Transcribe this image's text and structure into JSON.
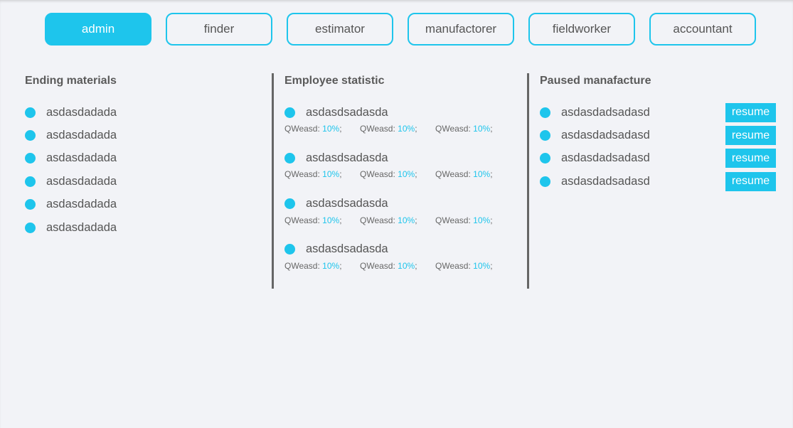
{
  "roles": [
    {
      "label": "admin",
      "active": true
    },
    {
      "label": "finder",
      "active": false
    },
    {
      "label": "estimator",
      "active": false
    },
    {
      "label": "manufactorer",
      "active": false
    },
    {
      "label": "fieldworker",
      "active": false
    },
    {
      "label": "accountant",
      "active": false
    }
  ],
  "ending_materials": {
    "title": "Ending materials",
    "items": [
      "asdasdadada",
      "asdasdadada",
      "asdasdadada",
      "asdasdadada",
      "asdasdadada",
      "asdasdadada"
    ]
  },
  "employee_statistic": {
    "title": "Employee statistic",
    "employees": [
      {
        "name": "asdasdsadasda",
        "stats": [
          {
            "label": "QWeasd:",
            "value": "10%",
            "sep": ";"
          },
          {
            "label": "QWeasd:",
            "value": "10%",
            "sep": ";"
          },
          {
            "label": "QWeasd:",
            "value": "10%",
            "sep": ";"
          }
        ]
      },
      {
        "name": "asdasdsadasda",
        "stats": [
          {
            "label": "QWeasd:",
            "value": "10%",
            "sep": ";"
          },
          {
            "label": "QWeasd:",
            "value": "10%",
            "sep": ";"
          },
          {
            "label": "QWeasd:",
            "value": "10%",
            "sep": ";"
          }
        ]
      },
      {
        "name": "asdasdsadasda",
        "stats": [
          {
            "label": "QWeasd:",
            "value": "10%",
            "sep": ";"
          },
          {
            "label": "QWeasd:",
            "value": "10%",
            "sep": ";"
          },
          {
            "label": "QWeasd:",
            "value": "10%",
            "sep": ";"
          }
        ]
      },
      {
        "name": "asdasdsadasda",
        "stats": [
          {
            "label": "QWeasd:",
            "value": "10%",
            "sep": ";"
          },
          {
            "label": "QWeasd:",
            "value": "10%",
            "sep": ";"
          },
          {
            "label": "QWeasd:",
            "value": "10%",
            "sep": ";"
          }
        ]
      }
    ]
  },
  "paused_manufacture": {
    "title": "Paused manafacture",
    "items": [
      {
        "name": "asdasdadsadasd",
        "action": "resume"
      },
      {
        "name": "asdasdadsadasd",
        "action": "resume"
      },
      {
        "name": "asdasdadsadasd",
        "action": "resume"
      },
      {
        "name": "asdasdadsadasd",
        "action": "resume"
      }
    ]
  },
  "colors": {
    "accent": "#1ec5ec",
    "background": "#f2f3f7",
    "divider": "#666666"
  }
}
